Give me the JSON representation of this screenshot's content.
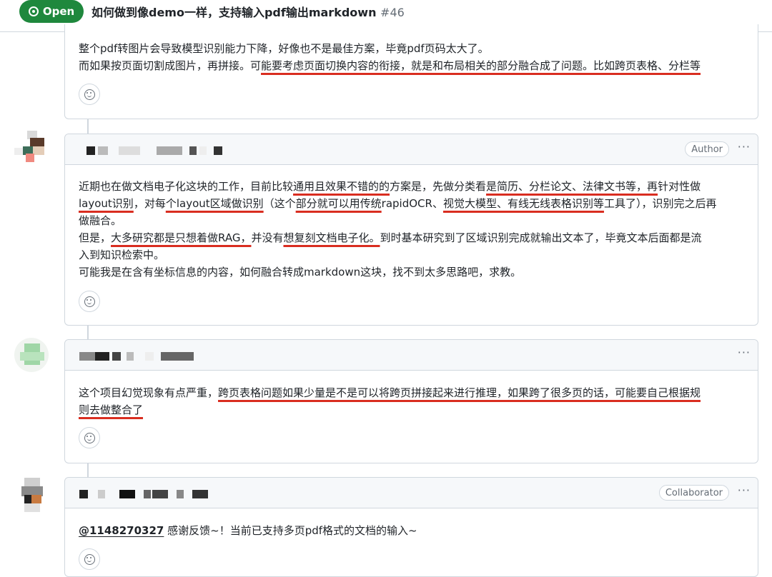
{
  "issue": {
    "state": "Open",
    "title": "如何做到像demo一样，支持输入pdf输出markdown",
    "number": "#46"
  },
  "comments": [
    {
      "lines": [
        "整个pdf转图片会导致模型识别能力下降，好像也不是最佳方案，毕竟pdf页码太大了。",
        "而如果按页面切割成图片，再拼接。可能要考虑页面切换内容的衔接，就是和布局相关的部分融合成了问题。比如跨页表格、分栏等"
      ]
    },
    {
      "role": "Author",
      "lines": [
        "近期也在做文档电子化这块的工作，目前比较通用且效果不错的的方案是，先做分类看是简历、分栏论文、法律文书等，再针对性做",
        "layout识别，对每个layout区域做识别（这个部分就可以用传统rapidOCR、视觉大模型、有线无线表格识别等工具了），识别完之后再",
        "做融合。",
        "但是，大多研究都是只想着做RAG，并没有想复刻文档电子化。到时基本研究到了区域识别完成就输出文本了，毕竟文本后面都是流",
        "入到知识检索中。",
        "可能我是在含有坐标信息的内容，如何融合转成markdown这块，找不到太多思路吧，求教。"
      ]
    },
    {
      "lines": [
        "这个项目幻觉现象有点严重，跨页表格问题如果少量是不是可以将跨页拼接起来进行推理，如果跨了很多页的话，可能要自己根据规",
        "则去做整合了"
      ]
    },
    {
      "role": "Collaborator",
      "mention": "@1148270327",
      "text": "感谢反馈~！当前已支持多页pdf格式的文档的输入~"
    }
  ],
  "menu_glyph": "···",
  "colors": {
    "open": "#1f883d",
    "underline": "#d92d20",
    "border": "#d0d7de"
  },
  "icons": [
    "issue-opened-icon",
    "smiley-icon",
    "kebab-horizontal-icon"
  ]
}
